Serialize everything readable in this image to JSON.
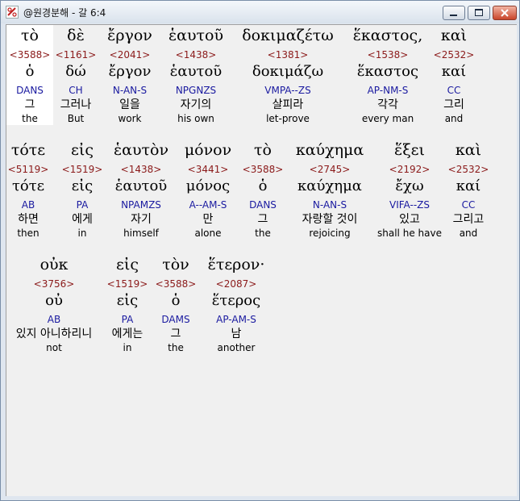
{
  "window": {
    "title": "@원경분해 - 갈 6:4"
  },
  "rows": [
    [
      {
        "greek": "τὸ",
        "strong": "<3588>",
        "lemma": "ὁ",
        "parse": "DANS",
        "korean": "그",
        "english": "the",
        "selected": true
      },
      {
        "greek": "δὲ",
        "strong": "<1161>",
        "lemma": "δώ",
        "parse": "CH",
        "korean": "그러나",
        "english": "But"
      },
      {
        "greek": "ἔργον",
        "strong": "<2041>",
        "lemma": "ἔργον",
        "parse": "N-AN-S",
        "korean": "일을",
        "english": "work"
      },
      {
        "greek": "ἑαυτοῦ",
        "strong": "<1438>",
        "lemma": "ἑαυτοῦ",
        "parse": "NPGNZS",
        "korean": "자기의",
        "english": "his own"
      },
      {
        "greek": "δοκιμαζέτω",
        "strong": "<1381>",
        "lemma": "δοκιμάζω",
        "parse": "VMPA--ZS",
        "korean": "살피라",
        "english": "let-prove"
      },
      {
        "greek": "ἕκαστος,",
        "strong": "<1538>",
        "lemma": "ἕκαστος",
        "parse": "AP-NM-S",
        "korean": "각각",
        "english": "every man"
      },
      {
        "greek": "καὶ",
        "strong": "<2532>",
        "lemma": "καί",
        "parse": "CC",
        "korean": "그리",
        "english": "and"
      }
    ],
    [
      {
        "greek": "τότε",
        "strong": "<5119>",
        "lemma": "τότε",
        "parse": "AB",
        "korean": "하면",
        "english": "then"
      },
      {
        "greek": "εἰς",
        "strong": "<1519>",
        "lemma": "εἰς",
        "parse": "PA",
        "korean": "에게",
        "english": "in"
      },
      {
        "greek": "ἑαυτὸν",
        "strong": "<1438>",
        "lemma": "ἑαυτοῦ",
        "parse": "NPAMZS",
        "korean": "자기",
        "english": "himself"
      },
      {
        "greek": "μόνον",
        "strong": "<3441>",
        "lemma": "μόνος",
        "parse": "A--AM-S",
        "korean": "만",
        "english": "alone"
      },
      {
        "greek": "τὸ",
        "strong": "<3588>",
        "lemma": "ὁ",
        "parse": "DANS",
        "korean": "그",
        "english": "the"
      },
      {
        "greek": "καύχημα",
        "strong": "<2745>",
        "lemma": "καύχημα",
        "parse": "N-AN-S",
        "korean": "자랑할 것이",
        "english": "rejoicing"
      },
      {
        "greek": "ἕξει",
        "strong": "<2192>",
        "lemma": "ἔχω",
        "parse": "VIFA--ZS",
        "korean": "있고",
        "english": "shall he have"
      },
      {
        "greek": "καὶ",
        "strong": "<2532>",
        "lemma": "καί",
        "parse": "CC",
        "korean": "그리고",
        "english": "and"
      }
    ],
    [
      {
        "greek": "οὐκ",
        "strong": "<3756>",
        "lemma": "οὐ",
        "parse": "AB",
        "korean": "있지 아니하리니",
        "english": "not"
      },
      {
        "greek": "εἰς",
        "strong": "<1519>",
        "lemma": "εἰς",
        "parse": "PA",
        "korean": "에게는",
        "english": "in"
      },
      {
        "greek": "τὸν",
        "strong": "<3588>",
        "lemma": "ὁ",
        "parse": "DAMS",
        "korean": "그",
        "english": "the"
      },
      {
        "greek": "ἕτερον·",
        "strong": "<2087>",
        "lemma": "ἕτερος",
        "parse": "AP-AM-S",
        "korean": "남",
        "english": "another"
      }
    ]
  ]
}
